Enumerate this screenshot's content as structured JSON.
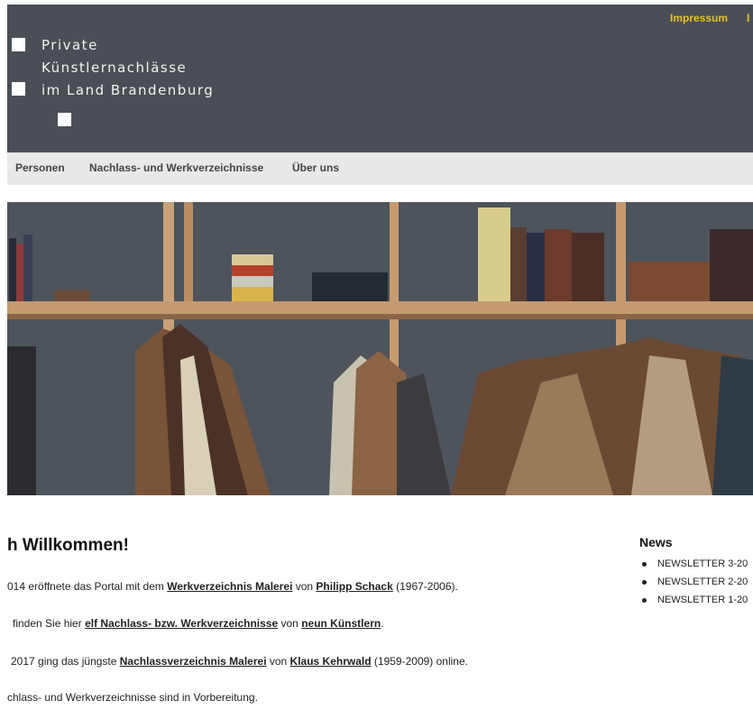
{
  "header": {
    "logo_lines": [
      "Private",
      "Künstlernachlässe",
      "im Land Brandenburg"
    ],
    "impressum": "Impressum",
    "impressum_cut": "I"
  },
  "colors": {
    "header_bg": "#4a4f55",
    "accent": "#e6c229",
    "nav_bg": "#e9e9e9"
  },
  "nav": {
    "items": [
      "Personen",
      "Nachlass- und Werkverzeichnisse",
      "Über uns"
    ]
  },
  "hero": {
    "image": "bookshelf-with-paintings"
  },
  "main": {
    "title": "h Willkommen!",
    "p1": {
      "t1": "014 eröffnete das Portal mit dem ",
      "l1": "Werkverzeichnis Malerei",
      "t2": " von ",
      "l2": "Philipp Schack",
      "t3": " (1967-2006)."
    },
    "p2": {
      "t1": "finden Sie hier ",
      "l1": "elf Nachlass- bzw. Werkverzeichnisse",
      "t2": " von ",
      "l2": "neun Künstlern",
      "t3": "."
    },
    "p3": {
      "t1": "2017 ging das jüngste ",
      "l1": "Nachlassverzeichnis Malerei",
      "t2": " von ",
      "l2": "Klaus Kehrwald",
      "t3": " (1959-2009) online."
    },
    "p4": {
      "t1": "chlass- und Werkverzeichnisse sind in Vorbereitung."
    }
  },
  "news": {
    "title": "News",
    "items": [
      "NEWSLETTER 3-20",
      "NEWSLETTER 2-20",
      "NEWSLETTER 1-20"
    ]
  }
}
